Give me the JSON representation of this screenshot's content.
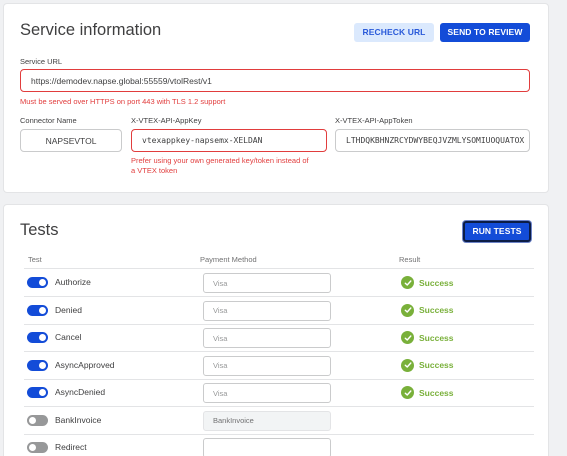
{
  "service": {
    "title": "Service information",
    "recheck_label": "RECHECK URL",
    "review_label": "SEND TO REVIEW",
    "url_label": "Service URL",
    "url_value": "https://demodev.napse.global:55559/vtolRest/v1",
    "url_error": "Must be served over HTTPS on port 443 with TLS 1.2 support",
    "connector_label": "Connector Name",
    "connector_value": "NAPSEVTOL",
    "appkey_label": "X-VTEX-API-AppKey",
    "appkey_value": "vtexappkey-napsemx-XELDAN",
    "appkey_error_1": "Prefer using your own generated key/token instead of",
    "appkey_error_2": "a VTEX token",
    "apptoken_label": "X-VTEX-API-AppToken",
    "apptoken_value": "LTHDQKBHNZRCYDWYBEQJVZMLYSOMIUOQUATOX"
  },
  "tests": {
    "title": "Tests",
    "run_label": "RUN TESTS",
    "columns": [
      "Test",
      "Payment Method",
      "Result"
    ],
    "rows": [
      {
        "name": "Authorize",
        "enabled": true,
        "method_placeholder": "Visa",
        "result": "Success"
      },
      {
        "name": "Denied",
        "enabled": true,
        "method_placeholder": "Visa",
        "result": "Success"
      },
      {
        "name": "Cancel",
        "enabled": true,
        "method_placeholder": "Visa",
        "result": "Success"
      },
      {
        "name": "AsyncApproved",
        "enabled": true,
        "method_placeholder": "Visa",
        "result": "Success"
      },
      {
        "name": "AsyncDenied",
        "enabled": true,
        "method_placeholder": "Visa",
        "result": "Success"
      },
      {
        "name": "BankInvoice",
        "enabled": false,
        "method_value": "BankInvoice",
        "result": ""
      },
      {
        "name": "Redirect",
        "enabled": false,
        "method_placeholder": "",
        "result": ""
      }
    ]
  },
  "colors": {
    "primary": "#134cd8",
    "error": "#e13d3d",
    "success": "#79b03a"
  }
}
